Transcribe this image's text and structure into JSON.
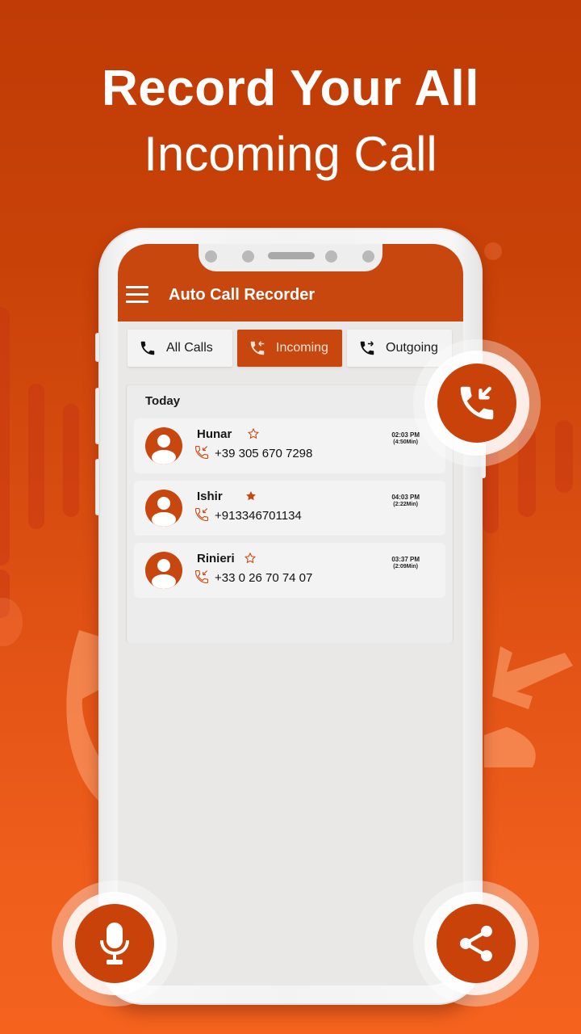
{
  "headline": {
    "line1": "Record Your All",
    "line2": "Incoming Call"
  },
  "app": {
    "title": "Auto Call Recorder",
    "menu_icon": "hamburger-menu-icon"
  },
  "tabs": [
    {
      "label": "All Calls",
      "icon": "phone-icon",
      "active": false
    },
    {
      "label": "Incoming",
      "icon": "incoming-call-icon",
      "active": true
    },
    {
      "label": "Outgoing",
      "icon": "outgoing-call-icon",
      "active": false
    }
  ],
  "call_list": {
    "section": "Today",
    "items": [
      {
        "name": "Hunar",
        "number": "+39 305 670 7298",
        "time": "02:03 PM",
        "duration": "(4:50Min)",
        "starred": false,
        "type": "incoming"
      },
      {
        "name": "Ishir",
        "number": "+913346701134",
        "time": "04:03 PM",
        "duration": "(2:22Min)",
        "starred": true,
        "type": "incoming"
      },
      {
        "name": "Rinieri",
        "number": "+33 0 26 70 74 07",
        "time": "03:37 PM",
        "duration": "(2:09Min)",
        "starred": false,
        "type": "incoming"
      }
    ]
  },
  "floating_buttons": [
    {
      "name": "incoming-call-badge",
      "icon": "incoming-call-icon"
    },
    {
      "name": "microphone-button",
      "icon": "microphone-icon"
    },
    {
      "name": "share-button",
      "icon": "share-icon"
    }
  ],
  "colors": {
    "brand": "#c8470f",
    "background_top": "#c03b06",
    "background_bottom": "#f4621e",
    "screen_bg": "#e9e8e7",
    "card_bg": "#f3f3f3"
  }
}
